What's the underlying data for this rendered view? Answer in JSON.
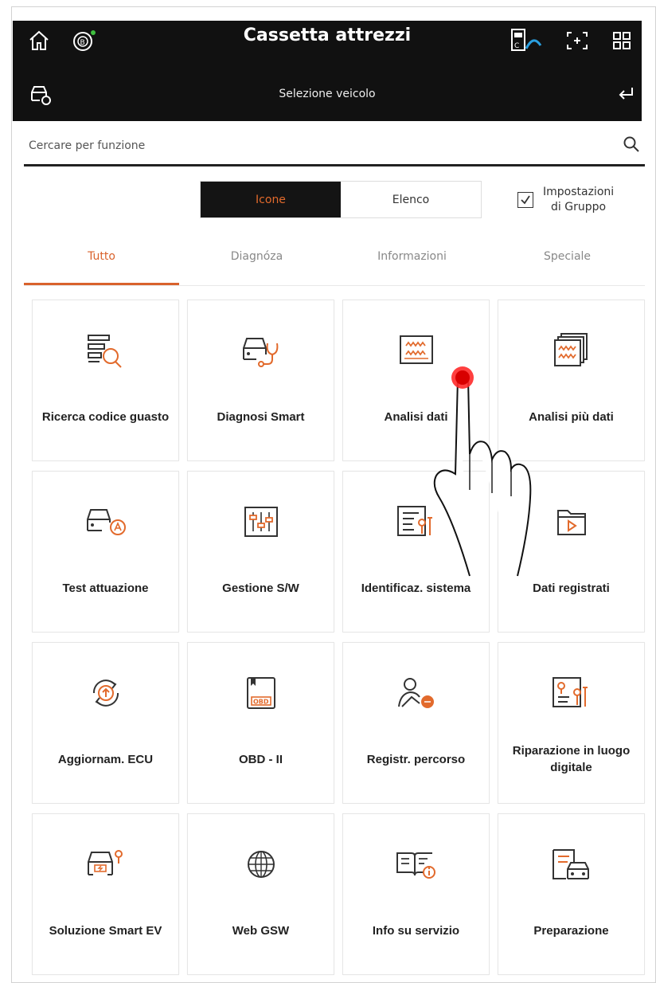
{
  "header": {
    "title": "Cassetta attrezzi",
    "subtitle": "Selezione veicolo",
    "icons": [
      "home-icon",
      "vci-status-icon",
      "vci-connect-icon",
      "screenshot-icon",
      "grid-menu-icon",
      "car-settings-icon",
      "back-icon"
    ]
  },
  "search": {
    "placeholder": "Cercare per funzione"
  },
  "view_toggle": {
    "icons_label": "Icone",
    "list_label": "Elenco",
    "active": "Icone"
  },
  "group_settings": {
    "label_line1": "Impostazioni",
    "label_line2": "di Gruppo",
    "checked": true
  },
  "tabs": [
    {
      "label": "Tutto",
      "active": true
    },
    {
      "label": "Diagnóza",
      "active": false
    },
    {
      "label": "Informazioni",
      "active": false
    },
    {
      "label": "Speciale",
      "active": false
    }
  ],
  "colors": {
    "accent": "#e26a2c",
    "header_bg": "#111111"
  },
  "tiles": [
    {
      "label": "Ricerca codice guasto",
      "icon": "dtc-search-icon"
    },
    {
      "label": "Diagnosi Smart",
      "icon": "smart-diagnosis-icon"
    },
    {
      "label": "Analisi dati",
      "icon": "data-analysis-icon"
    },
    {
      "label": "Analisi più dati",
      "icon": "multi-data-analysis-icon"
    },
    {
      "label": "Test attuazione",
      "icon": "actuation-test-icon"
    },
    {
      "label": "Gestione S/W",
      "icon": "sw-management-icon"
    },
    {
      "label": "Identificaz. sistema",
      "icon": "system-identification-icon"
    },
    {
      "label": "Dati registrati",
      "icon": "recorded-data-icon"
    },
    {
      "label": "Aggiornam. ECU",
      "icon": "ecu-update-icon"
    },
    {
      "label": "OBD - II",
      "icon": "obd-icon"
    },
    {
      "label": "Registr. percorso",
      "icon": "route-record-icon"
    },
    {
      "label": "Riparazione in luogo digitale",
      "icon": "digital-repair-icon"
    },
    {
      "label": "Soluzione Smart EV",
      "icon": "smart-ev-icon"
    },
    {
      "label": "Web GSW",
      "icon": "globe-icon"
    },
    {
      "label": "Info su servizio",
      "icon": "service-info-icon"
    },
    {
      "label": "Preparazione",
      "icon": "preparation-icon"
    }
  ],
  "tiles_obd_badge": "OBD"
}
